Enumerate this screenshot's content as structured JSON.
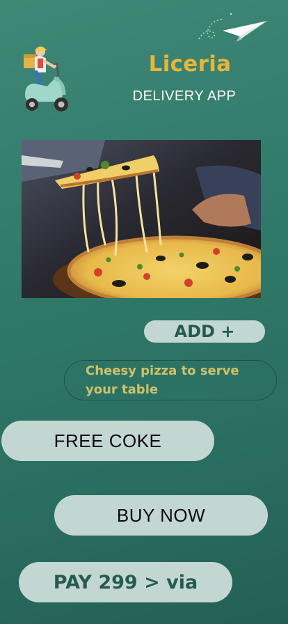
{
  "brand": {
    "title": "Liceria",
    "subtitle": "DELIVERY APP"
  },
  "icons": {
    "plane": "paper-plane-icon",
    "scooter": "delivery-scooter-icon"
  },
  "hero": {
    "image": "cheesy-pizza-slice-photo"
  },
  "actions": {
    "add_label": "ADD +",
    "tagline": "Cheesy pizza to serve your table",
    "free_coke_label": "FREE COKE",
    "buy_now_label": "BUY NOW",
    "pay_label": "PAY 299 > via"
  },
  "colors": {
    "background": "#2f7868",
    "accent_gold": "#e7b53c",
    "pill_bg": "#c3d7d2",
    "tagline_text": "#cfc16a",
    "dark_green_text": "#275a4e"
  }
}
